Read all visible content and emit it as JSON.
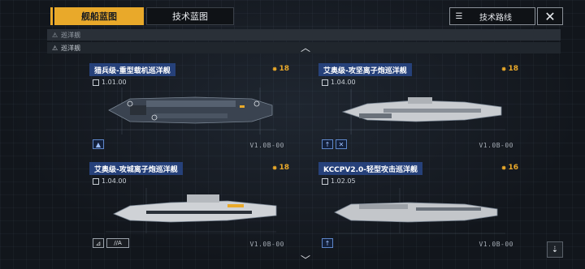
{
  "tabs": [
    {
      "label": "舰船蓝图",
      "active": true
    },
    {
      "label": "技术蓝图",
      "active": false
    }
  ],
  "toolbar": {
    "route_label": "技术路线",
    "route_icon": "list-icon",
    "close_icon": "close-icon",
    "close_glyph": "✕"
  },
  "filters": {
    "row1": "巡洋舰",
    "row2": "巡洋舰"
  },
  "ships": [
    {
      "name": "猎兵级-重型载机巡洋舰",
      "version": "1.01.00",
      "level": "18",
      "code": "V1.0B-00"
    },
    {
      "name": "艾奥级-攻坚离子炮巡洋舰",
      "version": "1.04.00",
      "level": "18",
      "code": "V1.0B-00"
    },
    {
      "name": "艾奥级-攻城离子炮巡洋舰",
      "version": "1.04.00",
      "level": "18",
      "code": "V1.0B-00"
    },
    {
      "name": "KCCPV2.0-轻型攻击巡洋舰",
      "version": "1.02.05",
      "level": "16",
      "code": "V1.0B-00"
    }
  ],
  "badges": {
    "ship3_wide": "//A"
  },
  "colors": {
    "accent": "#e9a92a",
    "title_bg": "#26417a",
    "background": "#14181e"
  }
}
